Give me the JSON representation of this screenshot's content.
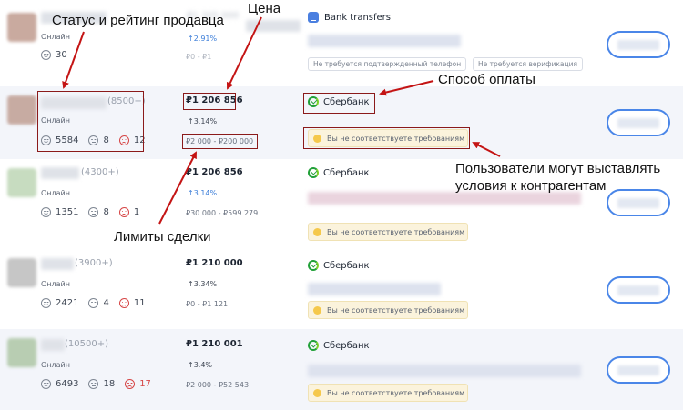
{
  "top_row": {
    "online": "Онлайн",
    "rating_pos": "30",
    "price_blurred": "₽1 305 000",
    "pct": "↑2.91%",
    "limits": "₽0 - ₽1",
    "bank": "Bank transfers",
    "tags": [
      "Не требуется подтвержденный телефон",
      "Не требуется верификация"
    ]
  },
  "offers": [
    {
      "count": "(8500+)",
      "online": "Онлайн",
      "pos": "5584",
      "neu": "8",
      "neg": "12",
      "price": "₽1 206 856",
      "pct": "↑3.14%",
      "limits": "₽2 000 - ₽200 000",
      "bank": "Сбербанк",
      "requirement": "Вы не соответствуете требованиям"
    },
    {
      "count": "(4300+)",
      "online": "Онлайн",
      "pos": "1351",
      "neu": "8",
      "neg": "1",
      "price": "₽1 206 856",
      "pct": "↑3.14%",
      "limits": "₽30 000 - ₽599 279",
      "bank": "Сбербанк",
      "requirement": "Вы не соответствуете требованиям"
    },
    {
      "count": "(3900+)",
      "online": "Онлайн",
      "pos": "2421",
      "neu": "4",
      "neg": "11",
      "price": "₽1 210 000",
      "pct": "↑3.34%",
      "limits": "₽0 - ₽1 121",
      "bank": "Сбербанк",
      "requirement": "Вы не соответствуете требованиям"
    },
    {
      "count": "(10500+)",
      "online": "Онлайн",
      "pos": "6493",
      "neu": "18",
      "neg": "17",
      "price": "₽1 210 001",
      "pct": "↑3.4%",
      "limits": "₽2 000 - ₽52 543",
      "bank": "Сбербанк",
      "requirement": "Вы не соответствуете требованиям"
    }
  ],
  "annotations": {
    "seller": "Статус и рейтинг продавца",
    "price": "Цена",
    "payment": "Способ оплаты",
    "limits": "Лимиты сделки",
    "conditions_line1": "Пользователи могут выставлять",
    "conditions_line2": "условия к контрагентам"
  },
  "colors": {
    "accent": "#4a86e8",
    "sber_green": "#21a038",
    "negative": "#d64545",
    "annotation_box": "#8b1a1a",
    "requirement_bg": "#fbf3dc"
  }
}
